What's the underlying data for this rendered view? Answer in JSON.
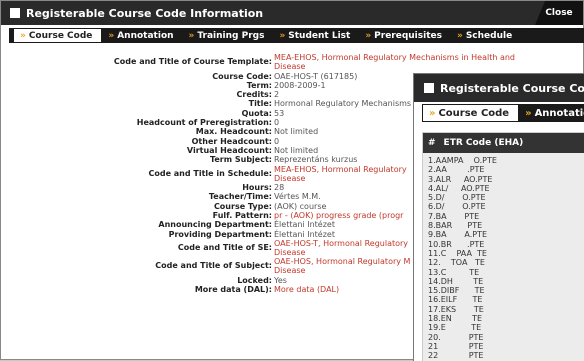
{
  "window": {
    "title": "Registerable Course Code Information",
    "close_label": "Close"
  },
  "tabs": [
    {
      "label": "Course Code",
      "active": true
    },
    {
      "label": "Annotation",
      "active": false
    },
    {
      "label": "Training Prgs",
      "active": false
    },
    {
      "label": "Student List",
      "active": false
    },
    {
      "label": "Prerequisites",
      "active": false
    },
    {
      "label": "Schedule",
      "active": false
    }
  ],
  "details": [
    {
      "label": "Code and Title of Course Template:",
      "value": "MEA-EHOS, Hormonal Regulatory Mechanisms in Health and",
      "value2": "Disease",
      "link": true
    },
    {
      "label": "Course Code:",
      "value": "OAE-HOS-T (617185)",
      "link": false
    },
    {
      "label": "Term:",
      "value": "2008-2009-1",
      "link": false
    },
    {
      "label": "Credits:",
      "value": "2",
      "link": false
    },
    {
      "label": "Title:",
      "value": "Hormonal Regulatory Mechanisms",
      "link": false
    },
    {
      "label": "Quota:",
      "value": "53",
      "link": false
    },
    {
      "label": "Headcount of Preregistration:",
      "value": "0",
      "link": false
    },
    {
      "label": "Max. Headcount:",
      "value": "Not limited",
      "link": false
    },
    {
      "label": "Other Headcount:",
      "value": "0",
      "link": false
    },
    {
      "label": "Virtual Headcount:",
      "value": "Not limited",
      "link": false
    },
    {
      "label": "Term Subject:",
      "value": "Reprezentáns kurzus",
      "link": false
    },
    {
      "label": "Code and Title in Schedule:",
      "value": "MEA-EHOS, Hormonal Regulatory",
      "value2": "Disease",
      "link": true
    },
    {
      "label": "Hours:",
      "value": "28",
      "link": false
    },
    {
      "label": "Teacher/Time:",
      "value": "Vértes M.M.",
      "link": false
    },
    {
      "label": "Course Type:",
      "value": "(AOK) course",
      "link": false
    },
    {
      "label": "Fulf. Pattern:",
      "value": "pr - (AOK) progress grade (progr",
      "link": true
    },
    {
      "label": "Announcing Department:",
      "value": "Élettani Intézet",
      "link": false
    },
    {
      "label": "Providing Department:",
      "value": "Élettani Intézet",
      "link": false
    },
    {
      "label": "Code and Title of SE:",
      "value": "OAE-HOS-T, Hormonal Regulatory",
      "value2": "Disease",
      "link": true
    },
    {
      "label": "Code and Title of Subject:",
      "value": "OAE-HOS, Hormonal Regulatory M",
      "value2": "Disease",
      "link": true
    },
    {
      "label": "Locked:",
      "value": "Yes",
      "link": false
    },
    {
      "label": "More data (DAL):",
      "value": "More data (DAL)",
      "link": true
    }
  ],
  "popup": {
    "title": "Registerable Course Code I",
    "tabs": [
      {
        "label": "Course Code",
        "active": true
      },
      {
        "label": "Annotatio",
        "active": false
      }
    ],
    "grid_header_hash": "#",
    "grid_header": "ETR Code (EHA)",
    "rows": [
      "1.AAMPA    O.PTE",
      "2.AA        .PTE",
      "3.ALR     AO.PTE",
      "4.AL/     AO.PTE",
      "5.D/       O.PTE",
      "6.D/       O.PTE",
      "7.BA       PTE",
      "8.BAR      PTE",
      "9.BA       A.PTE",
      "10.BR      .PTE",
      "11.C    PAA  TE",
      "12.    TOA   TE",
      "13.C         TE",
      "14.DH        TE",
      "15.DIBF      TE",
      "16.EILF      TE",
      "17.EKS       TE",
      "18.EN        TE",
      "19.E          TE",
      "20.           PTE",
      "21            PTE",
      "22            PTE"
    ]
  },
  "colors": {
    "titlebar": "#2a2a2a",
    "accent_arrow": "#f0a020",
    "link": "#c0392b"
  }
}
